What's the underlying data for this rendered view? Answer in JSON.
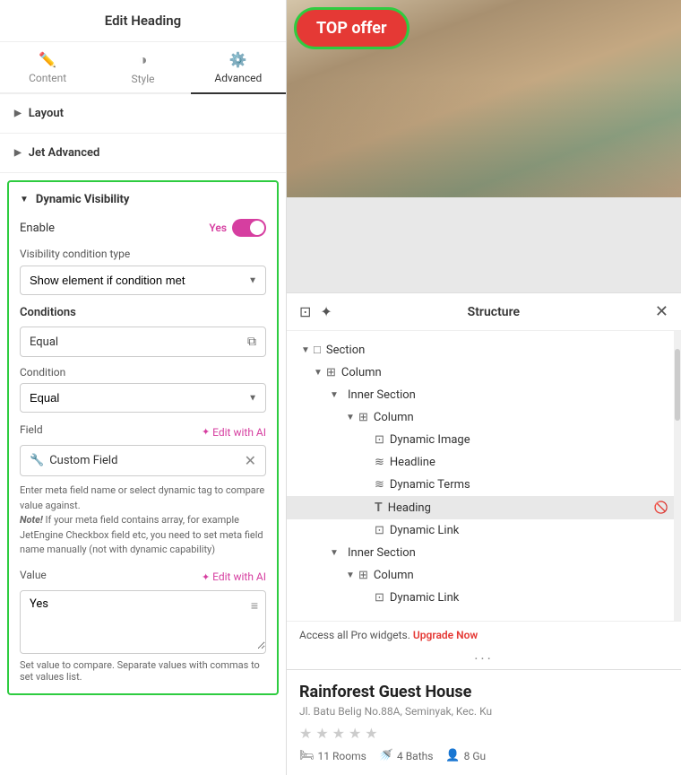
{
  "leftPanel": {
    "title": "Edit Heading",
    "tabs": [
      {
        "id": "content",
        "label": "Content",
        "icon": "✏️"
      },
      {
        "id": "style",
        "label": "Style",
        "icon": "◑"
      },
      {
        "id": "advanced",
        "label": "Advanced",
        "icon": "⚙️"
      }
    ],
    "sections": [
      {
        "id": "layout",
        "label": "Layout"
      },
      {
        "id": "jet-advanced",
        "label": "Jet Advanced"
      }
    ],
    "dynamicVisibility": {
      "title": "Dynamic Visibility",
      "enableLabel": "Enable",
      "toggleValue": "Yes",
      "visibilityConditionTypeLabel": "Visibility condition type",
      "visibilityConditionValue": "Show element if condition met",
      "conditionsLabel": "Conditions",
      "conditionBoxValue": "Equal",
      "conditionLabel": "Condition",
      "conditionSelectValue": "Equal",
      "fieldLabel": "Field",
      "editWithAILabel": "Edit with AI",
      "customFieldLabel": "Custom Field",
      "helpText": "Enter meta field name or select dynamic tag to compare value against.",
      "noteLabel": "Note!",
      "noteText": " If your meta field contains array, for example JetEngine Checkbox field etc, you need to set meta field name manually (not with dynamic capability)",
      "valueLabel": "Value",
      "valueEditWithAILabel": "Edit with AI",
      "valueText": "Yes",
      "setValueHelpText": "Set value to compare. Separate values with commas to set values list."
    }
  },
  "rightPanel": {
    "topOffer": {
      "label": "TOP offer"
    },
    "structure": {
      "title": "Structure",
      "items": [
        {
          "id": "section",
          "label": "Section",
          "level": 0,
          "hasToggle": true,
          "toggled": true,
          "icon": "□"
        },
        {
          "id": "column1",
          "label": "Column",
          "level": 1,
          "hasToggle": true,
          "toggled": true,
          "icon": "⊞"
        },
        {
          "id": "inner-section1",
          "label": "Inner Section",
          "level": 2,
          "hasToggle": true,
          "toggled": true,
          "icon": ""
        },
        {
          "id": "column2",
          "label": "Column",
          "level": 3,
          "hasToggle": true,
          "toggled": true,
          "icon": "⊞"
        },
        {
          "id": "dynamic-image",
          "label": "Dynamic Image",
          "level": 4,
          "hasToggle": false,
          "icon": "⊡"
        },
        {
          "id": "headline",
          "label": "Headline",
          "level": 4,
          "hasToggle": false,
          "icon": "≋"
        },
        {
          "id": "dynamic-terms",
          "label": "Dynamic Terms",
          "level": 4,
          "hasToggle": false,
          "icon": "≋"
        },
        {
          "id": "heading",
          "label": "Heading",
          "level": 4,
          "hasToggle": false,
          "icon": "T",
          "highlighted": true,
          "hasEyeOff": true
        },
        {
          "id": "dynamic-link1",
          "label": "Dynamic Link",
          "level": 4,
          "hasToggle": false,
          "icon": "⊡"
        },
        {
          "id": "inner-section2",
          "label": "Inner Section",
          "level": 2,
          "hasToggle": true,
          "toggled": true,
          "icon": ""
        },
        {
          "id": "column3",
          "label": "Column",
          "level": 3,
          "hasToggle": true,
          "toggled": true,
          "icon": "⊞"
        },
        {
          "id": "dynamic-link2",
          "label": "Dynamic Link",
          "level": 4,
          "hasToggle": false,
          "icon": "⊡"
        }
      ],
      "proText": "Access all Pro widgets.",
      "upgradeLabel": "Upgrade Now"
    },
    "card": {
      "title": "Rainforest Guest House",
      "address": "Jl. Batu Belig No.88A, Seminyak, Kec. Ku",
      "stars": "★★★★★",
      "stats": [
        {
          "icon": "🛏",
          "value": "11 Rooms"
        },
        {
          "icon": "🚿",
          "value": "4 Baths"
        },
        {
          "icon": "👤",
          "value": "8 Gu"
        }
      ]
    }
  }
}
